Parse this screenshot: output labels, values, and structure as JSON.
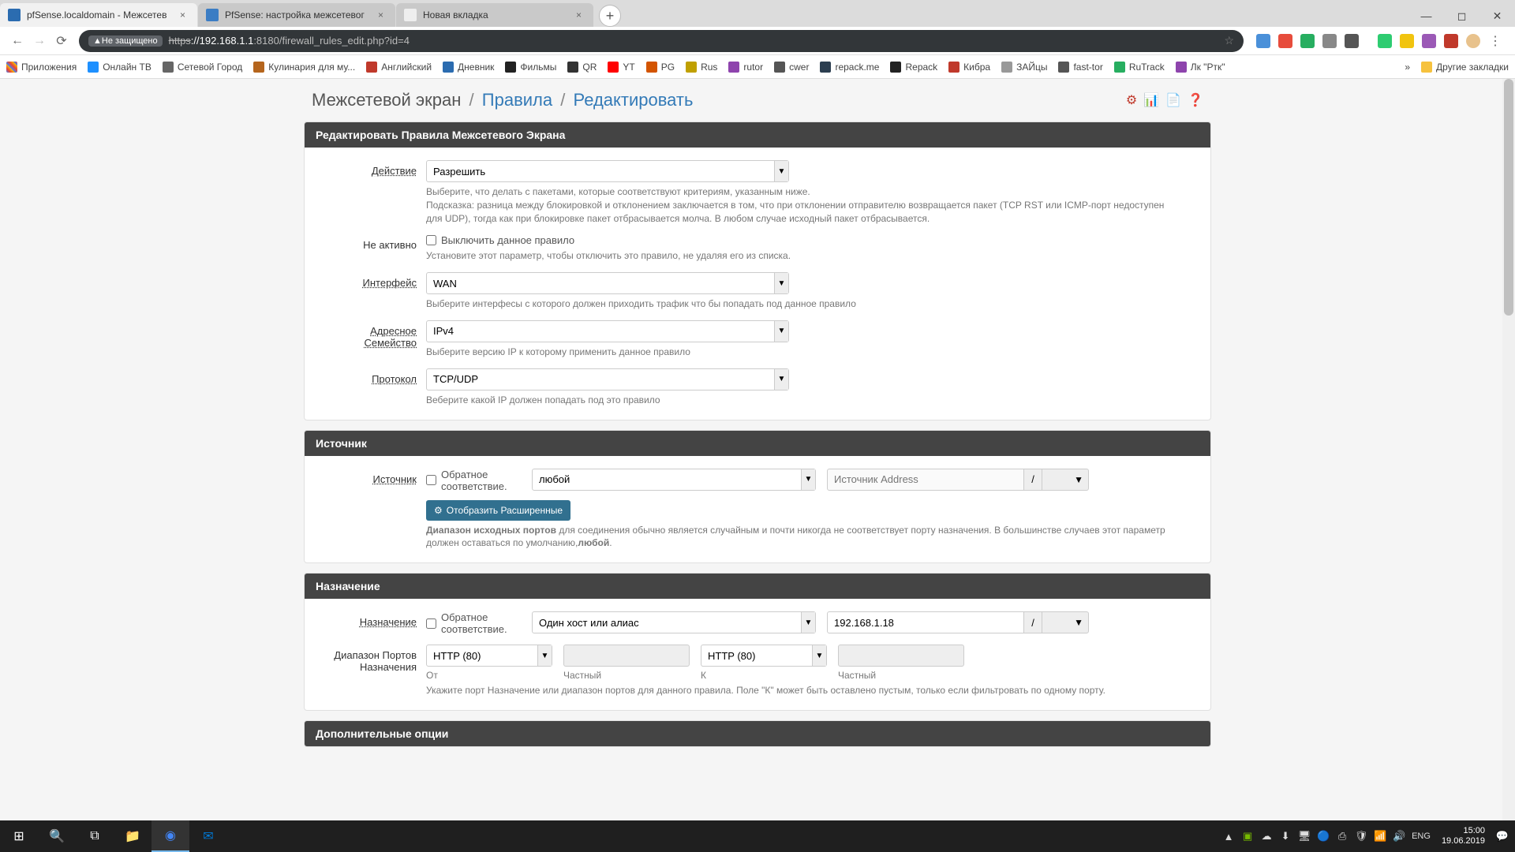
{
  "chrome": {
    "tabs": [
      {
        "title": "pfSense.localdomain - Межсетев",
        "active": true
      },
      {
        "title": "PfSense: настройка межсетевог",
        "active": false
      },
      {
        "title": "Новая вкладка",
        "active": false
      }
    ],
    "url_secure_label": "Не защищено",
    "url_prefix_strike": "https",
    "url_host": "://192.168.1.1",
    "url_path": ":8180/firewall_rules_edit.php?id=4",
    "bookmarks": [
      {
        "label": "Приложения",
        "color": "#777"
      },
      {
        "label": "Онлайн ТВ",
        "color": "#1e90ff"
      },
      {
        "label": "Сетевой Город",
        "color": "#666"
      },
      {
        "label": "Кулинария для му...",
        "color": "#b5651d"
      },
      {
        "label": "Английский",
        "color": "#c0392b"
      },
      {
        "label": "Дневник",
        "color": "#2b6cb0"
      },
      {
        "label": "Фильмы",
        "color": "#222"
      },
      {
        "label": "QR",
        "color": "#333"
      },
      {
        "label": "YT",
        "color": "#ff0000"
      },
      {
        "label": "PG",
        "color": "#d35400"
      },
      {
        "label": "Rus",
        "color": "#c0a000"
      },
      {
        "label": "rutor",
        "color": "#8e44ad"
      },
      {
        "label": "cwer",
        "color": "#555"
      },
      {
        "label": "repack.me",
        "color": "#2c3e50"
      },
      {
        "label": "Repack",
        "color": "#222"
      },
      {
        "label": "Кибра",
        "color": "#c0392b"
      },
      {
        "label": "ЗАЙцы",
        "color": "#999"
      },
      {
        "label": "fast-tor",
        "color": "#555"
      },
      {
        "label": "RuTrack",
        "color": "#27ae60"
      },
      {
        "label": "Лк \"Ртк\"",
        "color": "#8e44ad"
      }
    ],
    "other_bookmarks": "Другие закладки"
  },
  "breadcrumb": {
    "part1": "Межсетевой экран",
    "part2": "Правила",
    "part3": "Редактировать"
  },
  "panel1": {
    "title": "Редактировать Правила Межсетевого Экрана",
    "action_label": "Действие",
    "action_value": "Разрешить",
    "action_help": "Выберите, что делать с пакетами, которые соответствуют критериям, указанным ниже.\nПодсказка: разница между блокировкой и отклонением заключается в том, что при отклонении отправителю возвращается пакет (TCP RST или ICMP-порт недоступен для UDP), тогда как при блокировке пакет отбрасывается молча. В любом случае исходный пакет отбрасывается.",
    "inactive_label": "Не активно",
    "inactive_check": "Выключить данное правило",
    "inactive_help": "Установите этот параметр, чтобы отключить это правило, не удаляя его из списка.",
    "iface_label": "Интерфейс",
    "iface_value": "WAN",
    "iface_help": "Выберите интерфесы с которого должен приходить трафик что бы попадать под данное правило",
    "family_label": "Адресное Семейство",
    "family_value": "IPv4",
    "family_help": "Выберите версию IP к которому применить данное правило",
    "proto_label": "Протокол",
    "proto_value": "TCP/UDP",
    "proto_help": "Веберите какой IP должен попадать под это правило"
  },
  "panel2": {
    "title": "Источник",
    "src_label": "Источник",
    "invert_label": "Обратное соответствие.",
    "type_value": "любой",
    "addr_placeholder": "Источник Address",
    "expand_btn": "Отобразить Расширенные",
    "help_bold": "Диапазон исходных портов",
    "help_rest": " для соединения обычно является случайным и почти никогда не соответствует порту назначения. В большинстве случаев этот параметр должен оставаться по умолчанию,",
    "help_bold2": "любой",
    "help_dot": "."
  },
  "panel3": {
    "title": "Назначение",
    "dst_label": "Назначение",
    "invert_label": "Обратное соответствие.",
    "type_value": "Один хост или алиас",
    "addr_value": "192.168.1.18",
    "port_label": "Диапазон Портов Назначения",
    "from_sel": "HTTP (80)",
    "from_lbl": "От",
    "from_custom_lbl": "Частный",
    "to_sel": "HTTP (80)",
    "to_lbl": "К",
    "to_custom_lbl": "Частный",
    "help": "Укажите порт Назначение или диапазон портов для данного правила. Поле \"К\" может быть оставлено пустым, только если фильтровать по одному порту."
  },
  "panel4": {
    "title": "Дополнительные опции"
  },
  "taskbar": {
    "lang": "ENG",
    "time": "15:00",
    "date": "19.06.2019"
  }
}
